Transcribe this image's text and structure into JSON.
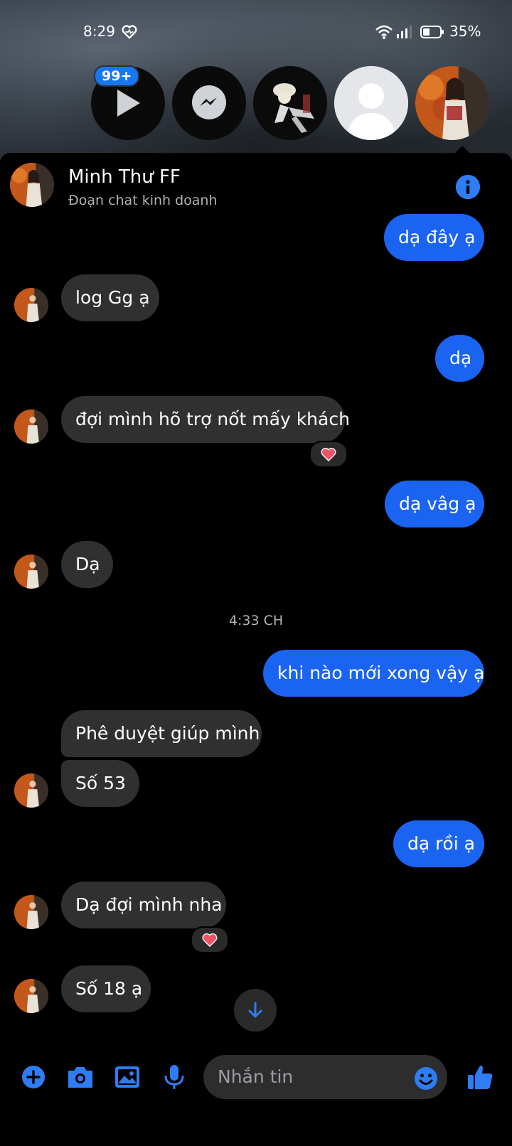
{
  "status_bar": {
    "time": "8:29",
    "battery": "35%"
  },
  "chat_heads": {
    "badge": "99+"
  },
  "header": {
    "name": "Minh Thư FF",
    "subtitle": "Đoạn chat kinh doanh"
  },
  "messages": [
    {
      "from": "me",
      "text": "dạ đây ạ"
    },
    {
      "from": "them",
      "text": "log Gg ạ"
    },
    {
      "from": "me",
      "text": "dạ"
    },
    {
      "from": "them",
      "text": "đợi mình hõ trợ nốt mấy khách",
      "reaction": "heart"
    },
    {
      "from": "me",
      "text": "dạ vâg ạ"
    },
    {
      "from": "them",
      "text": "Dạ"
    },
    {
      "from": "me",
      "text": "khi nào mới xong vậy ạ"
    },
    {
      "from": "them",
      "text": "Phê duyệt giúp mình"
    },
    {
      "from": "them",
      "text": "Số 53"
    },
    {
      "from": "me",
      "text": "dạ rồi ạ"
    },
    {
      "from": "them",
      "text": "Dạ đợi mình nha",
      "reaction": "heart"
    },
    {
      "from": "them",
      "text": "Số 18 ạ"
    }
  ],
  "timestamp": "4:33 CH",
  "composer": {
    "placeholder": "Nhắn tin"
  },
  "colors": {
    "outgoing": "#1b64f2",
    "incoming": "#303030",
    "accent": "#2e7df6",
    "background": "#000000"
  },
  "icons": [
    "plus-icon",
    "camera-icon",
    "image-icon",
    "microphone-icon",
    "emoji-icon",
    "thumbs-up-icon",
    "info-icon",
    "arrow-down-icon",
    "messenger-icon",
    "play-icon",
    "heart-reaction-icon"
  ]
}
